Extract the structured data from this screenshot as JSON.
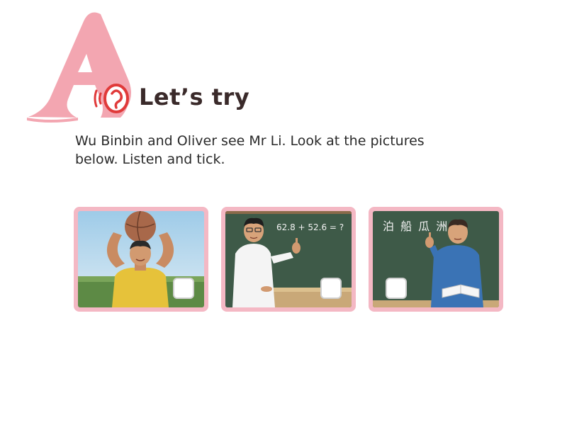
{
  "header": {
    "section_letter": "A",
    "title": "Let’s try",
    "icon": "ear-listen-icon"
  },
  "instructions": {
    "line1": "Wu Binbin and Oliver see Mr Li. Look at the pictures",
    "line2": "below. Listen and tick."
  },
  "cards": [
    {
      "name": "basketball-player",
      "icon": "man-holding-ball-picture"
    },
    {
      "name": "maths-teacher",
      "icon": "teacher-at-blackboard-picture",
      "board_text": "62.8 + 52.6 = ?"
    },
    {
      "name": "chinese-teacher",
      "icon": "teacher-with-book-picture",
      "board_text": "泊 船 瓜 洲"
    }
  ],
  "colors": {
    "letter_pink": "#f3a6b1",
    "card_border": "#f4b8c4",
    "title_text": "#3a2a2a",
    "ear_red": "#e03a3a"
  }
}
